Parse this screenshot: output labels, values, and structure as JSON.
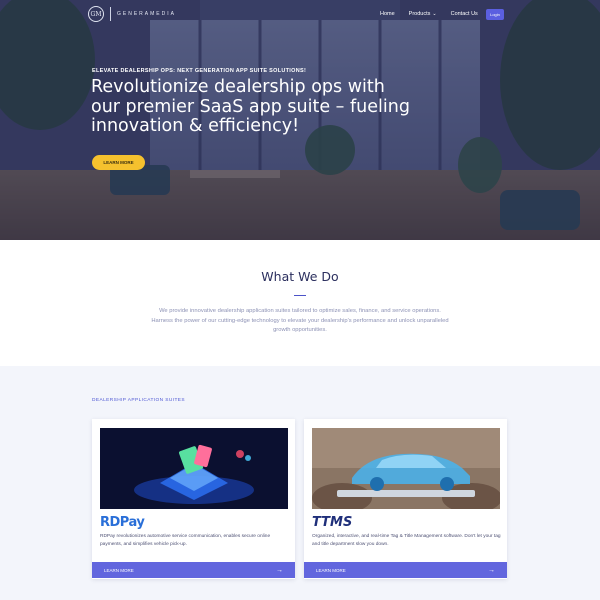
{
  "nav": {
    "logo_mark": "GM",
    "logo_text": "GENERAMEDIA",
    "items": [
      {
        "label": "Home"
      },
      {
        "label": "Products",
        "has_dropdown": true
      },
      {
        "label": "Contact Us"
      }
    ],
    "login_label": "Login"
  },
  "hero": {
    "eyebrow": "ELEVATE DEALERSHIP OPS: NEXT GENERATION APP SUITE SOLUTIONS!",
    "title": "Revolutionize dealership ops with our premier SaaS app suite – fueling innovation & efficiency!",
    "cta_label": "LEARN MORE"
  },
  "what_we_do": {
    "title": "What We Do",
    "body": "We provide innovative dealership application suites tailored to optimize sales, finance, and service operations. Harness the power of our cutting-edge technology to elevate your dealership's performance and unlock unparalleled growth opportunities."
  },
  "suites": {
    "label": "DEALERSHIP APPLICATION SUITES",
    "cards": [
      {
        "logo": "RDPay",
        "description": "RDPay revolutionizes automotive service communication, enables secure online payments, and simplifies vehicle pick-up.",
        "button_label": "LEARN MORE"
      },
      {
        "logo": "TTMS",
        "description": "Organized, interactive, and real-time Tag & Title Management software. Don't let your tag and title department slow you down.",
        "button_label": "LEARN MORE"
      }
    ]
  },
  "colors": {
    "accent": "#6266de",
    "cta_yellow": "#f5c12e",
    "heading_navy": "#2b2f5e",
    "section_bg": "#f3f5fb"
  },
  "icons": {
    "dropdown": "chevron-down-icon",
    "card_arrow": "arrow-right-icon"
  }
}
